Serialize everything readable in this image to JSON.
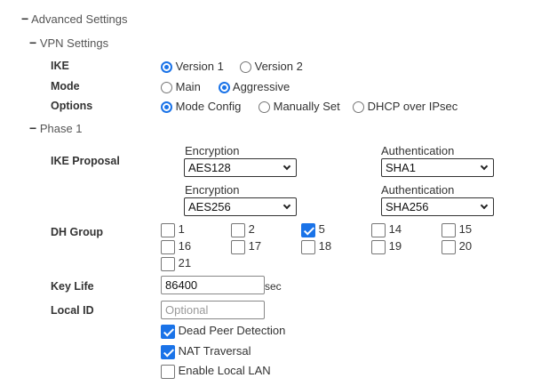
{
  "sections": {
    "advanced": {
      "toggle": "−",
      "title": "Advanced Settings"
    },
    "vpn": {
      "toggle": "−",
      "title": "VPN Settings"
    },
    "phase1": {
      "toggle": "−",
      "title": "Phase 1"
    }
  },
  "ike": {
    "label": "IKE",
    "options": [
      {
        "label": "Version 1",
        "selected": true
      },
      {
        "label": "Version 2",
        "selected": false
      }
    ]
  },
  "mode": {
    "label": "Mode",
    "options": [
      {
        "label": "Main",
        "selected": false
      },
      {
        "label": "Aggressive",
        "selected": true
      }
    ]
  },
  "options_row": {
    "label": "Options",
    "options": [
      {
        "label": "Mode Config",
        "selected": true
      },
      {
        "label": "Manually Set",
        "selected": false
      },
      {
        "label": "DHCP over IPsec",
        "selected": false
      }
    ]
  },
  "ike_proposal": {
    "label": "IKE Proposal",
    "rows": [
      {
        "encryption_label": "Encryption",
        "encryption": "AES128",
        "authentication_label": "Authentication",
        "authentication": "SHA1"
      },
      {
        "encryption_label": "Encryption",
        "encryption": "AES256",
        "authentication_label": "Authentication",
        "authentication": "SHA256"
      }
    ]
  },
  "dh_group": {
    "label": "DH Group",
    "items": [
      {
        "label": "1",
        "checked": false
      },
      {
        "label": "2",
        "checked": false
      },
      {
        "label": "5",
        "checked": true
      },
      {
        "label": "14",
        "checked": false
      },
      {
        "label": "15",
        "checked": false
      },
      {
        "label": "16",
        "checked": false
      },
      {
        "label": "17",
        "checked": false
      },
      {
        "label": "18",
        "checked": false
      },
      {
        "label": "19",
        "checked": false
      },
      {
        "label": "20",
        "checked": false
      },
      {
        "label": "21",
        "checked": false
      }
    ]
  },
  "key_life": {
    "label": "Key Life",
    "value": "86400",
    "unit": "sec"
  },
  "local_id": {
    "label": "Local ID",
    "value": "",
    "placeholder": "Optional"
  },
  "checkboxes": [
    {
      "label": "Dead Peer Detection",
      "checked": true
    },
    {
      "label": "NAT Traversal",
      "checked": true
    },
    {
      "label": "Enable Local LAN",
      "checked": false
    }
  ],
  "colors": {
    "accent": "#1a73e8",
    "text": "#333333"
  }
}
